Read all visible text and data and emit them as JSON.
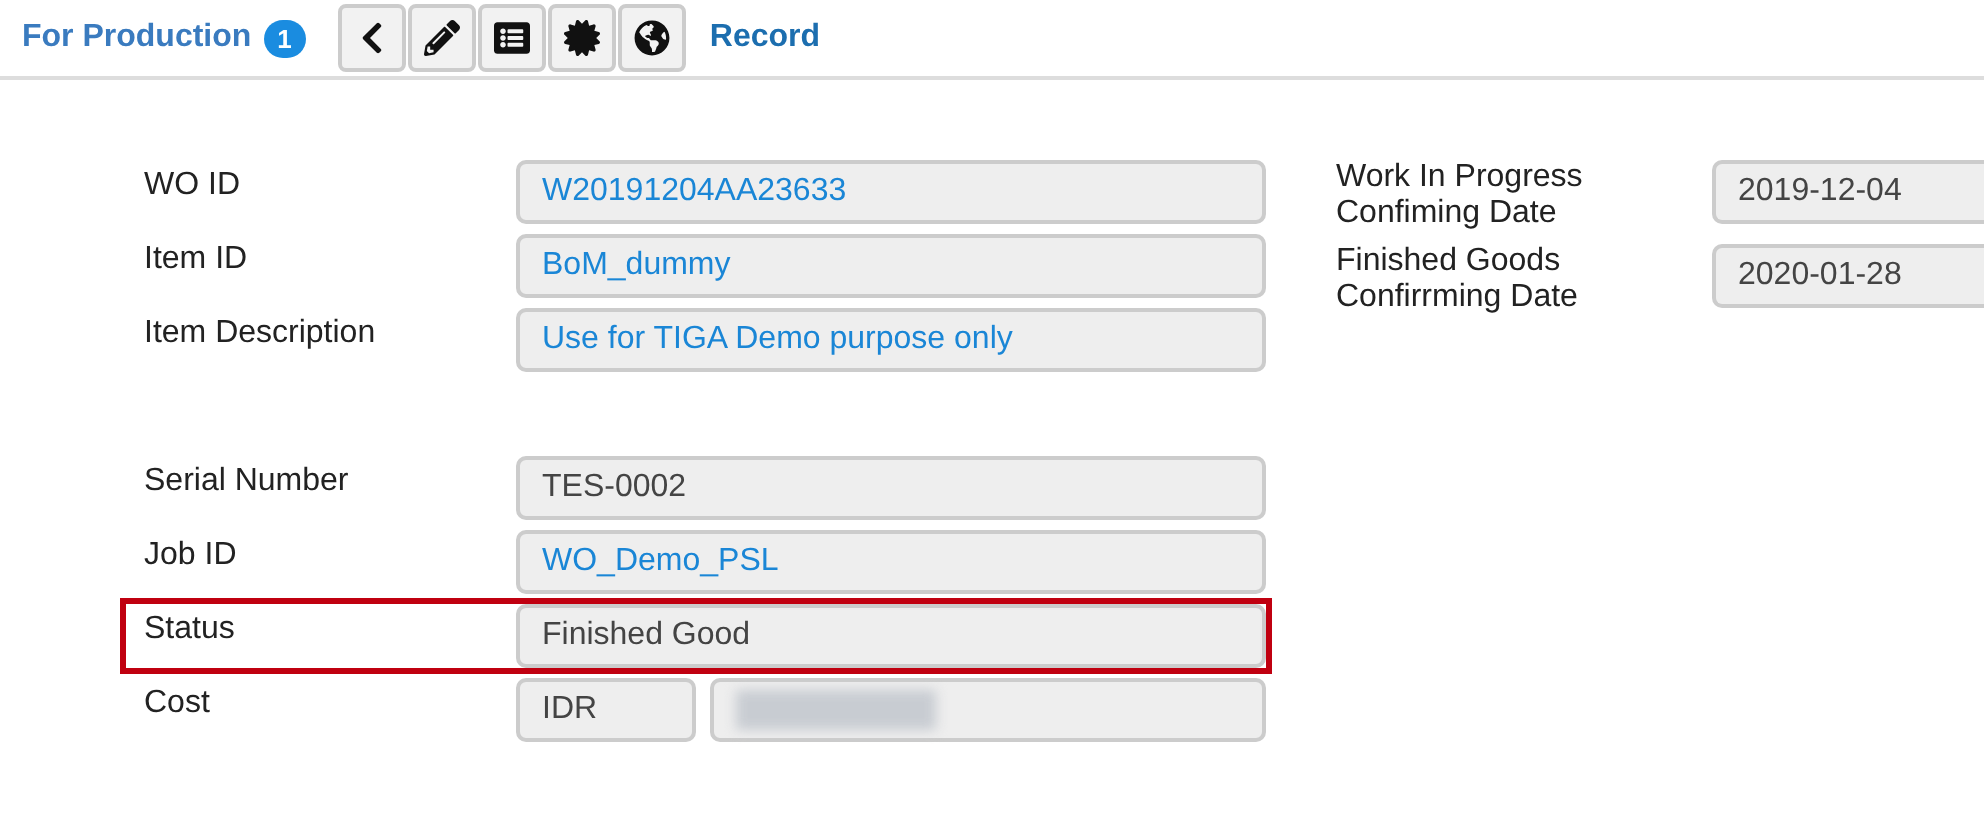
{
  "header": {
    "title": "For Production",
    "count": "1",
    "toolbar": [
      {
        "kind": "back"
      },
      {
        "kind": "edit"
      },
      {
        "kind": "list"
      },
      {
        "kind": "burst"
      },
      {
        "kind": "globe"
      }
    ],
    "link": "Record"
  },
  "left_groups": [
    [
      {
        "label": "WO ID",
        "value": "W20191204AA23633",
        "kind": "link",
        "highlighted": false
      },
      {
        "label": "Item ID",
        "value": "BoM_dummy",
        "kind": "link",
        "highlighted": false
      },
      {
        "label": "Item Description",
        "value": "Use for TIGA Demo purpose only",
        "kind": "link",
        "highlighted": false
      }
    ],
    [
      {
        "label": "Serial Number",
        "value": "TES-0002",
        "kind": "text",
        "highlighted": false
      },
      {
        "label": "Job ID",
        "value": "WO_Demo_PSL",
        "kind": "link",
        "highlighted": false
      },
      {
        "label": "Status",
        "value": "Finished Good",
        "kind": "text",
        "highlighted": true
      },
      {
        "label": "Cost",
        "value": "IDR",
        "kind": "currency",
        "redacted": true,
        "highlighted": false
      }
    ]
  ],
  "right_fields": [
    {
      "label": "Work In Progress Confiming Date",
      "value": "2019-12-04"
    },
    {
      "label": "Finished Goods Confirrming Date",
      "value": "2020-01-28"
    }
  ]
}
